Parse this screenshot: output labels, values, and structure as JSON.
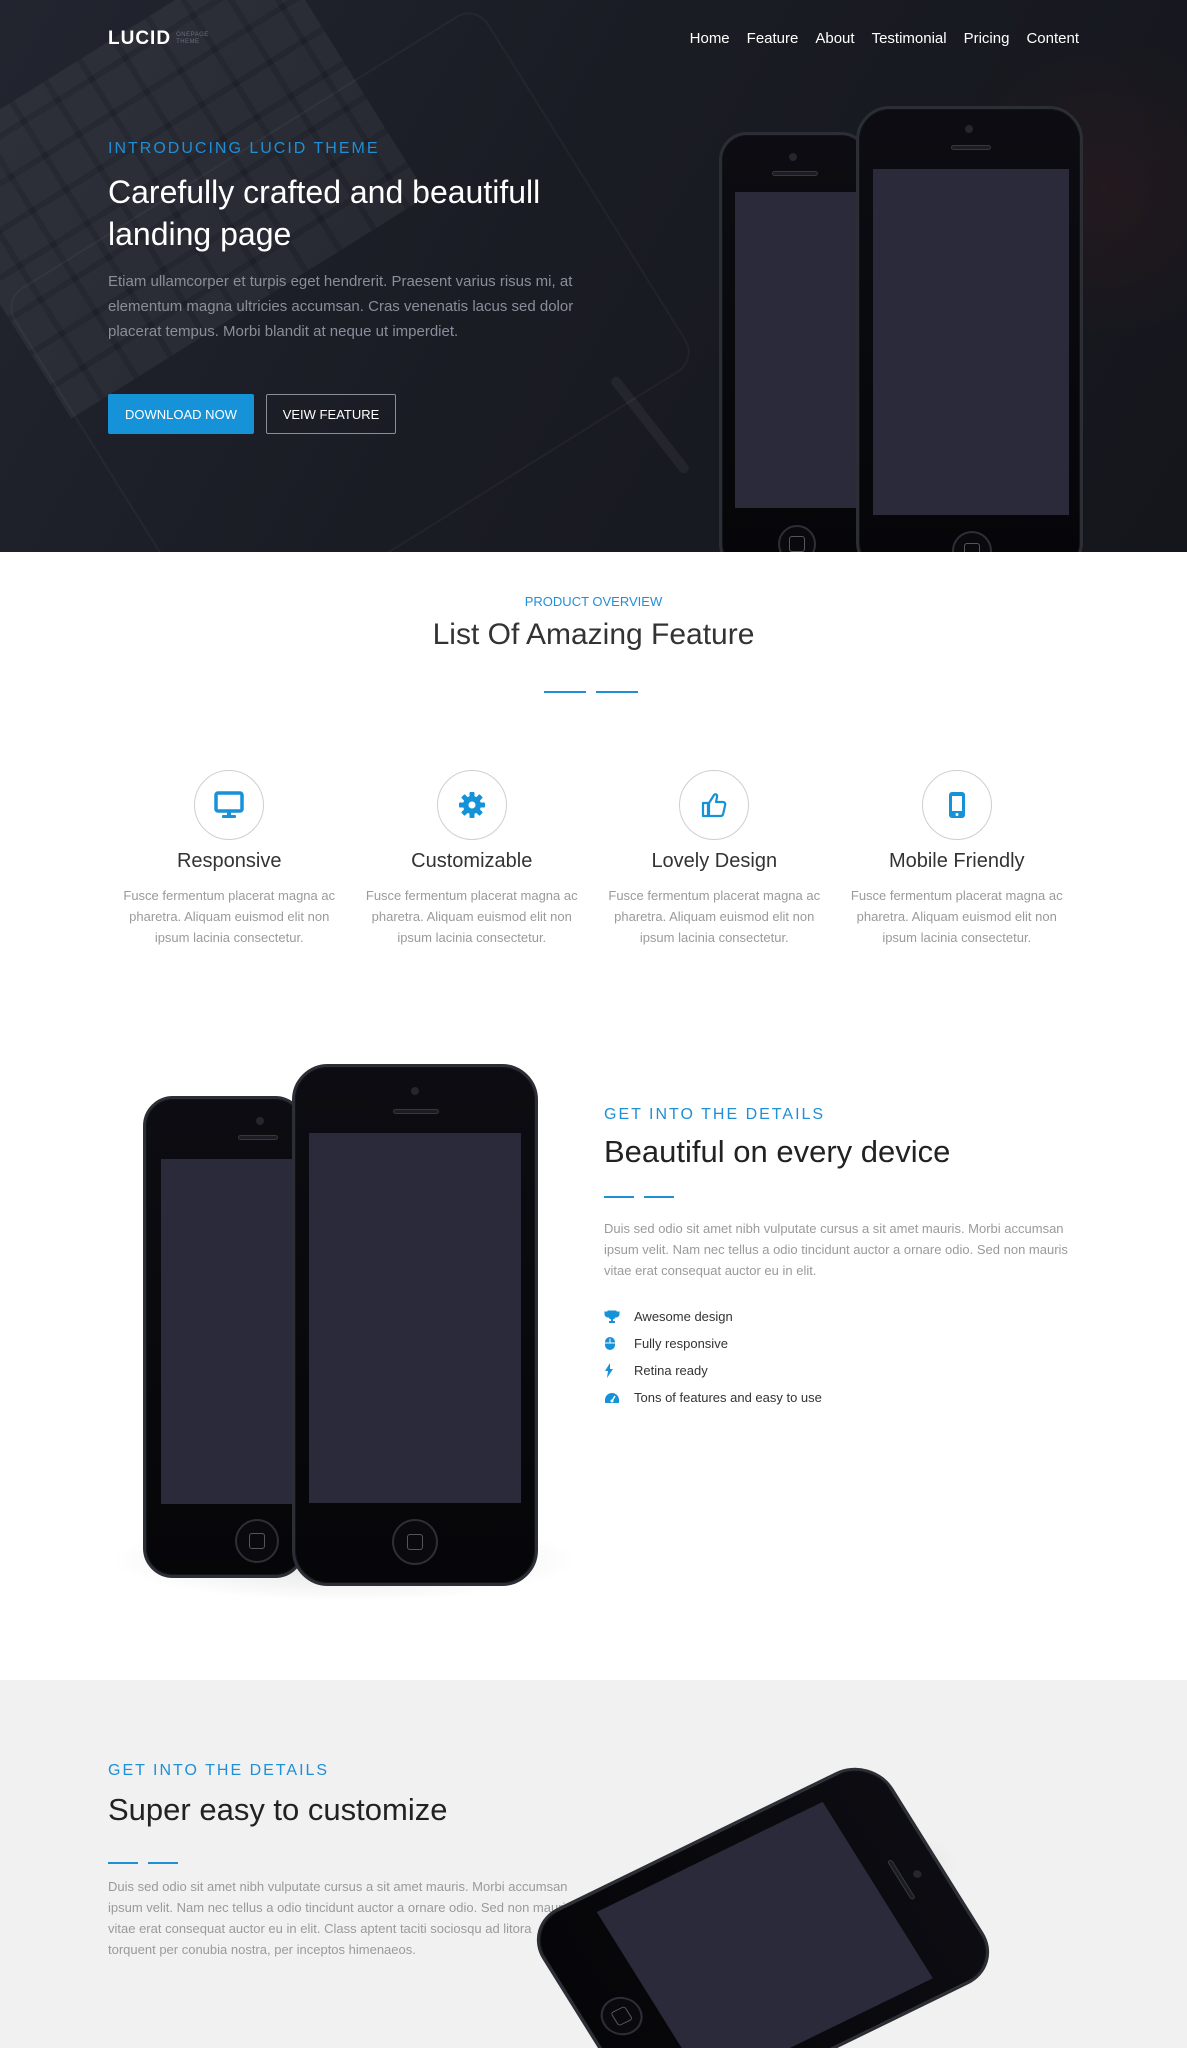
{
  "nav": {
    "logo": "LUCID",
    "logo_sub_1": "ONEPAGE",
    "logo_sub_2": "THEME",
    "links": [
      "Home",
      "Feature",
      "About",
      "Testimonial",
      "Pricing",
      "Content"
    ]
  },
  "hero": {
    "eyebrow": "INTRODUCING LUCID THEME",
    "title_line1": "Carefully crafted and beautifull",
    "title_line2": "landing page",
    "description": "Etiam ullamcorper et turpis eget hendrerit. Praesent varius risus mi, at elementum magna ultricies accumsan. Cras venenatis lacus sed dolor placerat tempus. Morbi blandit at neque ut imperdiet.",
    "primary_button": "DOWNLOAD NOW",
    "secondary_button": "VEIW FEATURE"
  },
  "overview": {
    "label": "PRODUCT OVERVIEW",
    "title": "List Of Amazing Feature",
    "features": [
      {
        "icon": "monitor-icon",
        "title": "Responsive",
        "desc": "Fusce fermentum placerat magna ac pharetra. Aliquam euismod elit non ipsum lacinia consectetur."
      },
      {
        "icon": "gear-icon",
        "title": "Customizable",
        "desc": "Fusce fermentum placerat magna ac pharetra. Aliquam euismod elit non ipsum lacinia consectetur."
      },
      {
        "icon": "thumbs-up-icon",
        "title": "Lovely Design",
        "desc": "Fusce fermentum placerat magna ac pharetra. Aliquam euismod elit non ipsum lacinia consectetur."
      },
      {
        "icon": "mobile-icon",
        "title": "Mobile Friendly",
        "desc": "Fusce fermentum placerat magna ac pharetra. Aliquam euismod elit non ipsum lacinia consectetur."
      }
    ]
  },
  "details": {
    "eyebrow": "GET INTO THE DETAILS",
    "title": "Beautiful on every device",
    "description": "Duis sed odio sit amet nibh vulputate cursus a sit amet mauris. Morbi accumsan ipsum velit. Nam nec tellus a odio tincidunt auctor a ornare odio. Sed non mauris vitae erat consequat auctor eu in elit.",
    "items": [
      {
        "icon": "trophy-icon",
        "label": "Awesome design"
      },
      {
        "icon": "mouse-icon",
        "label": "Fully responsive"
      },
      {
        "icon": "bolt-icon",
        "label": "Retina ready"
      },
      {
        "icon": "dashboard-icon",
        "label": "Tons of features and easy to use"
      }
    ]
  },
  "customize": {
    "eyebrow": "GET INTO THE DETAILS",
    "title": "Super easy to customize",
    "description": "Duis sed odio sit amet nibh vulputate cursus a sit amet mauris. Morbi accumsan ipsum velit. Nam nec tellus a odio tincidunt auctor a ornare odio. Sed non mauris vitae erat consequat auctor eu in elit. Class aptent taciti sociosqu ad litora torquent per conubia nostra, per inceptos himenaeos."
  },
  "colors": {
    "accent": "#1f8fd6",
    "primary_button": "#1592d8",
    "hero_bg": "#1a1c24",
    "screen": "#2b2a3a",
    "customize_bg": "#f1f1f1"
  }
}
